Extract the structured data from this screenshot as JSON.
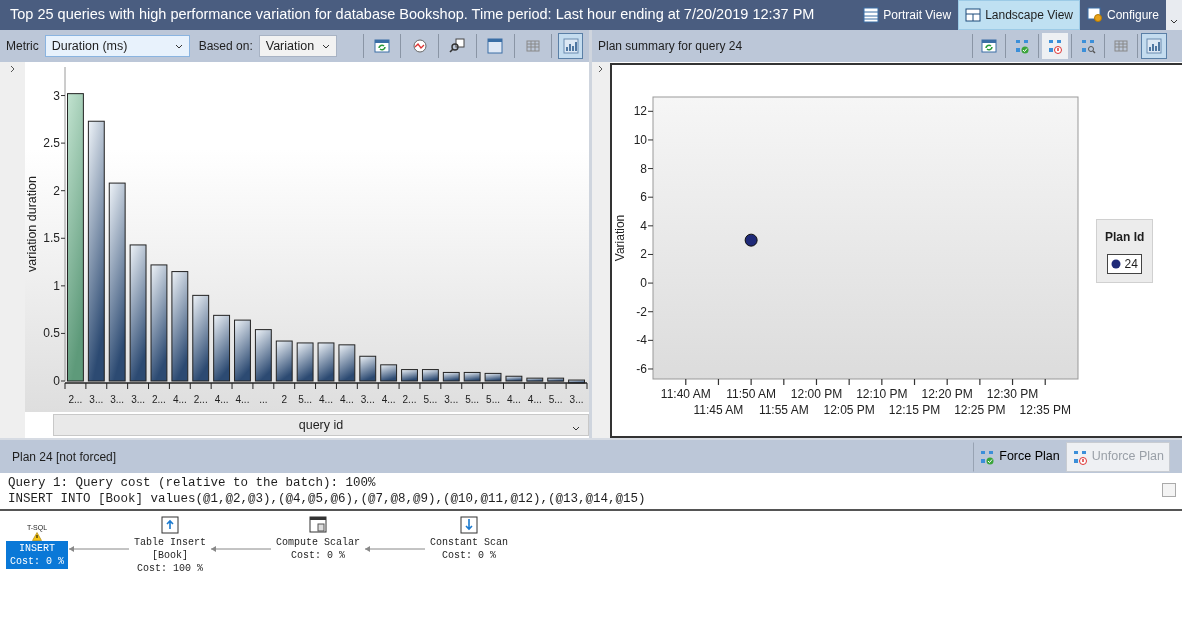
{
  "title": "Top 25 queries with high performance variation for database Bookshop. Time period: Last hour ending at 7/20/2019 12:37 PM",
  "view_buttons": [
    {
      "kind": "portrait",
      "label": "Portrait View",
      "selected": false
    },
    {
      "kind": "landscape",
      "label": "Landscape View",
      "selected": true
    },
    {
      "kind": "configure",
      "label": "Configure",
      "selected": false
    }
  ],
  "left_pane": {
    "metric_label": "Metric",
    "metric_value": "Duration (ms)",
    "based_on_label": "Based on:",
    "based_on_value": "Variation",
    "toolbar": [
      {
        "kind": "refresh",
        "selected": false
      },
      {
        "kind": "track",
        "selected": false
      },
      {
        "kind": "view-query",
        "selected": false
      },
      {
        "kind": "window",
        "selected": false
      },
      {
        "kind": "grid",
        "selected": false
      },
      {
        "kind": "chart",
        "selected": true
      }
    ],
    "chart_data": {
      "type": "bar",
      "ylabel": "variation duration",
      "categories": [
        "2...",
        "3...",
        "3...",
        "3...",
        "2...",
        "4...",
        "2...",
        "4...",
        "4...",
        "...",
        "2",
        "5...",
        "4...",
        "4...",
        "3...",
        "4...",
        "2...",
        "5...",
        "3...",
        "5...",
        "5...",
        "4...",
        "4...",
        "5...",
        "3..."
      ],
      "values": [
        3.02,
        2.73,
        2.08,
        1.43,
        1.22,
        1.15,
        0.9,
        0.69,
        0.64,
        0.54,
        0.42,
        0.4,
        0.4,
        0.38,
        0.26,
        0.17,
        0.12,
        0.12,
        0.09,
        0.09,
        0.08,
        0.05,
        0.03,
        0.03,
        0.01
      ],
      "ylim": [
        0,
        3.3
      ],
      "yticks": [
        0,
        0.5,
        1,
        1.5,
        2,
        2.5,
        3
      ]
    },
    "bar_states": [
      {
        "selected": true
      },
      {
        "selected": false
      },
      {
        "selected": false
      },
      {
        "selected": false
      },
      {
        "selected": false
      },
      {
        "selected": false
      },
      {
        "selected": false
      },
      {
        "selected": false
      },
      {
        "selected": false
      },
      {
        "selected": false
      },
      {
        "selected": false
      },
      {
        "selected": false
      },
      {
        "selected": false
      },
      {
        "selected": false
      },
      {
        "selected": false
      },
      {
        "selected": false
      },
      {
        "selected": false
      },
      {
        "selected": false
      },
      {
        "selected": false
      },
      {
        "selected": false
      },
      {
        "selected": false
      },
      {
        "selected": false
      },
      {
        "selected": false
      },
      {
        "selected": false
      },
      {
        "selected": false
      }
    ],
    "x_axis_selector": "query id"
  },
  "right_pane": {
    "title": "Plan summary for query 24",
    "toolbar": [
      {
        "kind": "refresh",
        "selected": false,
        "hover": false
      },
      {
        "kind": "force",
        "selected": false,
        "hover": false
      },
      {
        "kind": "unforce",
        "selected": false,
        "hover": true
      },
      {
        "kind": "compare",
        "selected": false,
        "hover": false
      },
      {
        "kind": "grid",
        "selected": false,
        "hover": false
      },
      {
        "kind": "chart",
        "selected": true,
        "hover": false
      }
    ],
    "chart_data": {
      "type": "scatter",
      "ylabel": "Variation",
      "categories": [
        "11:40 AM",
        "11:45 AM",
        "11:50 AM",
        "11:55 AM",
        "12:00 PM",
        "12:05 PM",
        "12:10 PM",
        "12:15 PM",
        "12:20 PM",
        "12:25 PM",
        "12:30 PM",
        "12:35 PM"
      ],
      "series": [
        {
          "name": "24",
          "color": "#1f2a78",
          "values": [
            null,
            null,
            3,
            null,
            null,
            null,
            null,
            null,
            null,
            null,
            null,
            null
          ]
        }
      ],
      "ylim": [
        -6.7,
        13
      ],
      "yticks": [
        -6,
        -4,
        -2,
        0,
        2,
        4,
        6,
        8,
        10,
        12
      ]
    },
    "legend": {
      "title": "Plan Id"
    }
  },
  "plan": {
    "title": "Plan 24 [not forced]",
    "buttons": [
      {
        "kind": "force",
        "label": "Force Plan",
        "disabled": false
      },
      {
        "kind": "unforce",
        "label": "Unforce Plan",
        "disabled": true
      }
    ],
    "query_lines": [
      "Query 1: Query cost (relative to the batch): 100%",
      "INSERT INTO [Book] values(@1,@2,@3),(@4,@5,@6),(@7,@8,@9),(@10,@11,@12),(@13,@14,@15)"
    ],
    "operators": [
      {
        "kind": "tsql",
        "badge": "T-SQL",
        "lines": [
          "INSERT",
          "Cost: 0 %"
        ],
        "selected": true,
        "warning": true
      },
      {
        "kind": "table-insert",
        "lines": [
          "Table Insert",
          "[Book]",
          "Cost: 100 %"
        ],
        "selected": false,
        "warning": false
      },
      {
        "kind": "compute-scalar",
        "lines": [
          "Compute Scalar",
          "Cost: 0 %"
        ],
        "selected": false,
        "warning": false
      },
      {
        "kind": "constant-scan",
        "lines": [
          "Constant Scan",
          "Cost: 0 %"
        ],
        "selected": false,
        "warning": false
      }
    ]
  }
}
